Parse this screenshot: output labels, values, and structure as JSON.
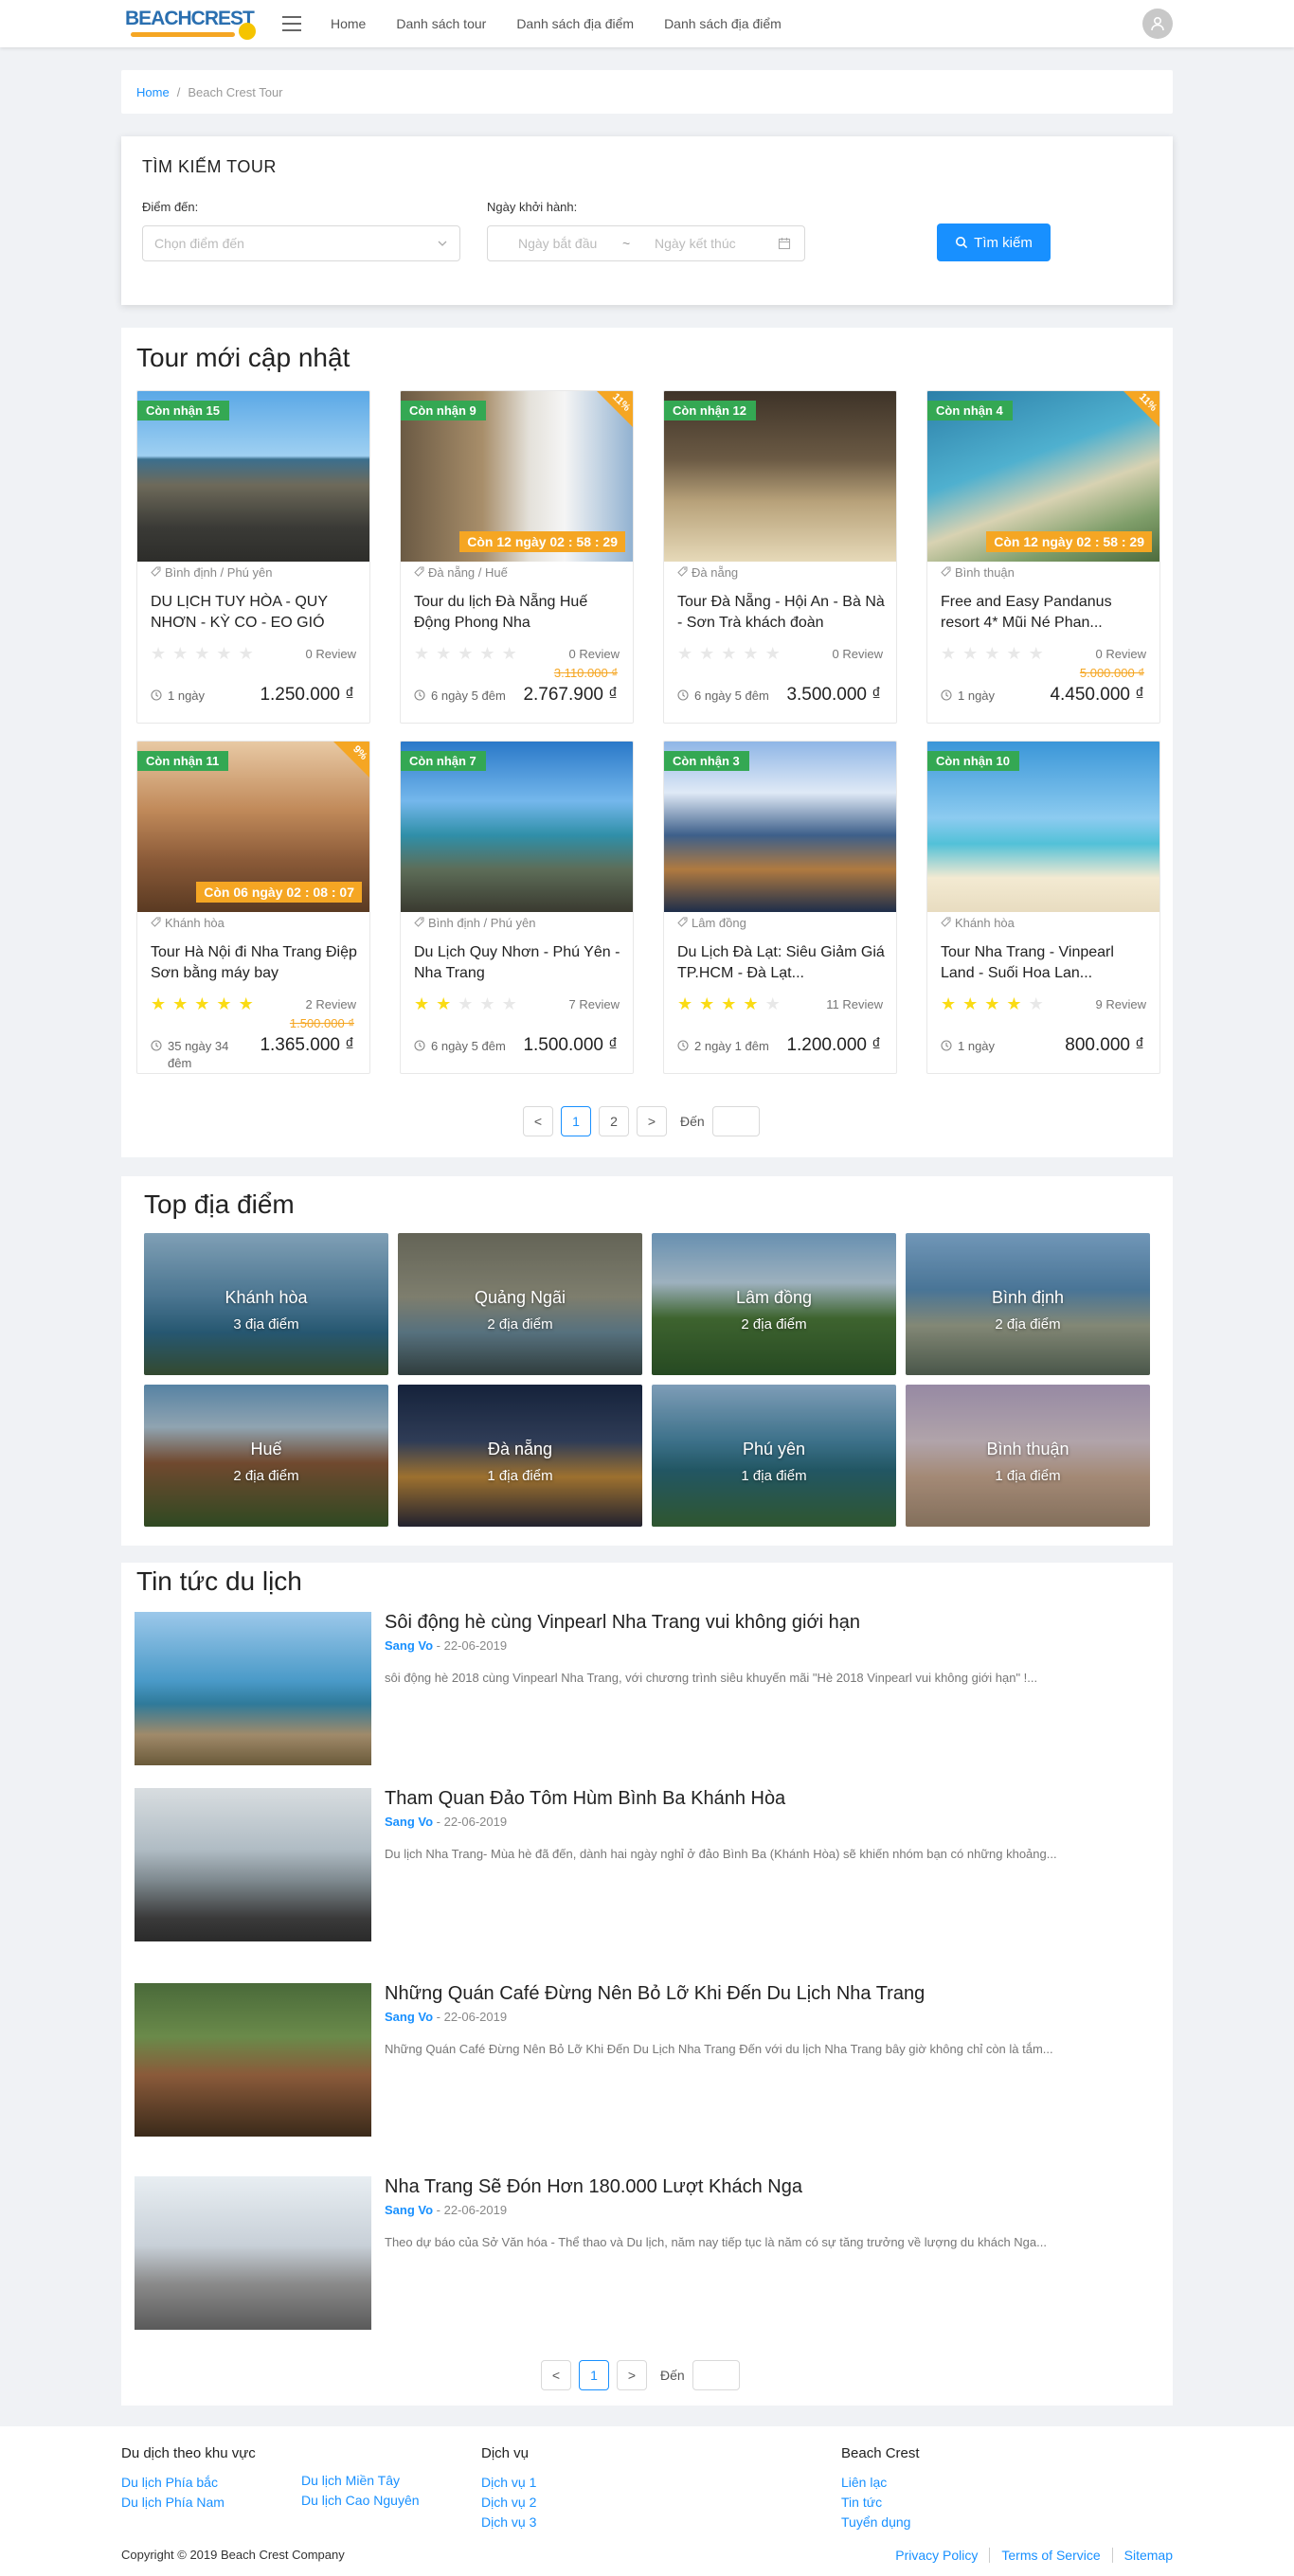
{
  "header": {
    "logo_text": "BEACHCREST",
    "nav": [
      "Home",
      "Danh sách tour",
      "Danh sách địa điểm",
      "Danh sách địa điểm"
    ]
  },
  "breadcrumb": {
    "home": "Home",
    "separator": "/",
    "current": "Beach Crest Tour"
  },
  "search": {
    "title": "TÌM KIẾM TOUR",
    "dest_label": "Điểm đến:",
    "dest_placeholder": "Chọn điểm đến",
    "date_label": "Ngày khởi hành:",
    "start_placeholder": "Ngày bắt đầu",
    "range_sep": "~",
    "end_placeholder": "Ngày kết thúc",
    "button": "Tìm kiếm"
  },
  "tours_section": {
    "title": "Tour mới cập nhật",
    "tours": [
      {
        "badge": "Còn nhận 15",
        "location": "Bình định / Phú yên",
        "title": "DU LỊCH TUY HÒA - QUY NHƠN - KỲ CO - EO GIÓ",
        "rating": 0,
        "reviews": "0 Review",
        "old_price": "",
        "duration": "1 ngày",
        "price": "1.250.000 ₫",
        "discount": "",
        "countdown": "",
        "img": "coast"
      },
      {
        "badge": "Còn nhận 9",
        "location": "Đà nẵng / Huế",
        "title": "Tour du lịch Đà Nẵng Huế Động Phong Nha",
        "rating": 0,
        "reviews": "0 Review",
        "old_price": "3.110.000 ₫",
        "duration": "6 ngày 5 đêm",
        "price": "2.767.900 ₫",
        "discount": "11%",
        "countdown": "Còn 12 ngày 02 : 58 : 29",
        "img": "cave"
      },
      {
        "badge": "Còn nhận 12",
        "location": "Đà nẵng",
        "title": "Tour Đà Nẵng - Hội An - Bà Nà - Sơn Trà khách đoàn",
        "rating": 0,
        "reviews": "0 Review",
        "old_price": "",
        "duration": "6 ngày 5 đêm",
        "price": "3.500.000 ₫",
        "discount": "",
        "countdown": "",
        "img": "hoian"
      },
      {
        "badge": "Còn nhận 4",
        "location": "Bình thuận",
        "title": "Free and Easy Pandanus resort 4* Mũi Né Phan...",
        "rating": 0,
        "reviews": "0 Review",
        "old_price": "5.000.000 ₫",
        "duration": "1 ngày",
        "price": "4.450.000 ₫",
        "discount": "11%",
        "countdown": "Còn 12 ngày 02 : 58 : 29",
        "img": "beach"
      },
      {
        "badge": "Còn nhận 11",
        "location": "Khánh hòa",
        "title": "Tour Hà Nội đi Nha Trang Điệp Sơn bằng máy bay",
        "rating": 4.5,
        "reviews": "2 Review",
        "old_price": "1.500.000 ₫",
        "duration": "35 ngày 34 đêm",
        "price": "1.365.000 ₫",
        "discount": "9%",
        "countdown": "Còn 06 ngày 02 : 08 : 07",
        "img": "tower"
      },
      {
        "badge": "Còn nhận 7",
        "location": "Bình định / Phú yên",
        "title": "Du Lịch Quy Nhơn - Phú Yên - Nha Trang",
        "rating": 2,
        "reviews": "7 Review",
        "old_price": "",
        "duration": "6 ngày 5 đêm",
        "price": "1.500.000 ₫",
        "discount": "",
        "countdown": "",
        "img": "sea"
      },
      {
        "badge": "Còn nhận 3",
        "location": "Lâm đồng",
        "title": "Du Lịch Đà Lạt: Siêu Giảm Giá TP.HCM - Đà Lạt...",
        "rating": 3.5,
        "reviews": "11 Review",
        "old_price": "",
        "duration": "2 ngày 1 đêm",
        "price": "1.200.000 ₫",
        "discount": "",
        "countdown": "",
        "img": "dalat"
      },
      {
        "badge": "Còn nhận 10",
        "location": "Khánh hòa",
        "title": "Tour Nha Trang - Vinpearl Land - Suối Hoa Lan...",
        "rating": 4,
        "reviews": "9 Review",
        "old_price": "",
        "duration": "1 ngày",
        "price": "800.000 ₫",
        "discount": "",
        "countdown": "",
        "img": "palm"
      }
    ],
    "pager": {
      "prev": "<",
      "pages": [
        "1",
        "2"
      ],
      "next": ">",
      "goto": "Đến"
    }
  },
  "places_section": {
    "title": "Top địa điểm",
    "places": [
      {
        "name": "Khánh hòa",
        "count": "3 địa điểm"
      },
      {
        "name": "Quảng Ngãi",
        "count": "2 địa điểm"
      },
      {
        "name": "Lâm đồng",
        "count": "2 địa điểm"
      },
      {
        "name": "Bình định",
        "count": "2 địa điểm"
      },
      {
        "name": "Huế",
        "count": "2 địa điểm"
      },
      {
        "name": "Đà nẵng",
        "count": "1 địa điểm"
      },
      {
        "name": "Phú yên",
        "count": "1 địa điểm"
      },
      {
        "name": "Bình thuận",
        "count": "1 địa điểm"
      }
    ]
  },
  "news_section": {
    "title": "Tin tức du lịch",
    "items": [
      {
        "title": "Sôi động hè cùng Vinpearl Nha Trang vui không giới hạn",
        "author": "Sang Vo",
        "date": " - 22-06-2019",
        "desc": "sôi động hè 2018 cùng Vinpearl Nha Trang, với chương trình siêu khuyến mãi \"Hè 2018 Vinpearl vui không giới hạn\" !..."
      },
      {
        "title": "Tham Quan Đảo Tôm Hùm Bình Ba Khánh Hòa",
        "author": "Sang Vo",
        "date": " - 22-06-2019",
        "desc": "Du lịch Nha Trang- Mùa hè đã đến, dành hai ngày nghỉ ở đảo Bình Ba (Khánh Hòa) sẽ khiến nhóm bạn có những khoảng..."
      },
      {
        "title": "Những Quán Café Đừng Nên Bỏ Lỡ Khi Đến Du Lịch Nha Trang",
        "author": "Sang Vo",
        "date": " - 22-06-2019",
        "desc": "Những Quán Café Đừng Nên Bỏ Lỡ Khi Đến Du Lịch Nha Trang Đến với du lịch Nha Trang bây giờ không chỉ còn là tắm..."
      },
      {
        "title": "Nha Trang Sẽ Đón Hơn 180.000 Lượt Khách Nga",
        "author": "Sang Vo",
        "date": " - 22-06-2019",
        "desc": "Theo dự báo của Sở Văn hóa - Thể thao và Du lịch, năm nay tiếp tục là năm có sự tăng trưởng về lượng du khách Nga..."
      }
    ],
    "pager": {
      "prev": "<",
      "pages": [
        "1"
      ],
      "next": ">",
      "goto": "Đến"
    }
  },
  "footer": {
    "col1_title": "Du dịch theo khu vực",
    "col1_links": [
      "Du lịch Phía bắc",
      "Du lịch Phía Nam"
    ],
    "col1b_links": [
      "Du lịch Miền Tây",
      "Du lịch Cao Nguyên"
    ],
    "col2_title": "Dịch vụ",
    "col2_links": [
      "Dịch vụ 1",
      "Dịch vụ 2",
      "Dịch vụ 3"
    ],
    "col3_title": "Beach Crest",
    "col3_links": [
      "Liên lạc",
      "Tin tức",
      "Tuyển dụng"
    ],
    "copyright": "Copyright © 2019 Beach Crest Company",
    "links": [
      "Privacy Policy",
      "Terms of Service",
      "Sitemap"
    ]
  },
  "colors": {
    "accent": "#1890ff",
    "badge": "#34a853",
    "discount": "#f5a623"
  }
}
